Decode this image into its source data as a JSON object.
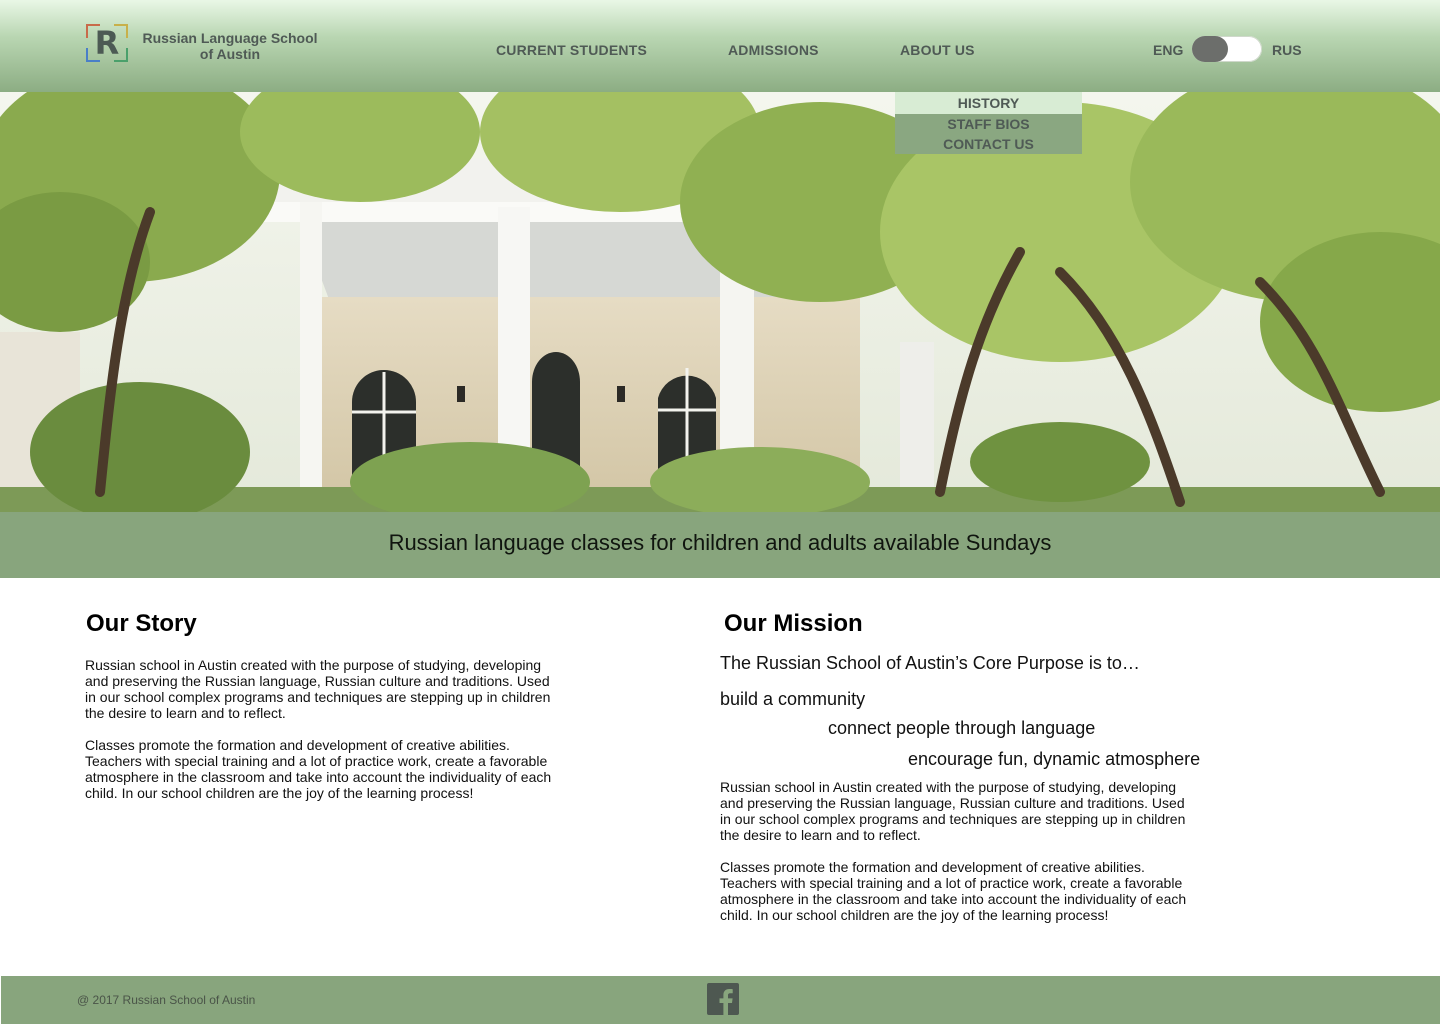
{
  "brand": {
    "logo_letter": "R",
    "name_line1": "Russian Language School",
    "name_line2": "of Austin"
  },
  "nav": {
    "items": [
      "CURRENT STUDENTS",
      "ADMISSIONS",
      "ABOUT US"
    ],
    "dropdown": [
      "HISTORY",
      "STAFF BIOS",
      "CONTACT US"
    ]
  },
  "language": {
    "left": "ENG",
    "right": "RUS",
    "selected": "ENG"
  },
  "banner": {
    "text": "Russian language classes for children and adults available Sundays"
  },
  "story": {
    "title": "Our Story",
    "para1": "Russian school in Austin created with the purpose of studying, developing and preserving the Russian language, Russian culture and traditions. Used in our school complex programs and techniques are stepping up in children the desire to learn and to reflect.",
    "para2": "Classes promote the formation and development of creative abilities. Teachers with special training and a lot of practice work, create a favorable atmosphere in the classroom and take into account the individuality of each child. In our school children are the joy of the learning process!"
  },
  "mission": {
    "title": "Our Mission",
    "intro": "The Russian School of Austin’s Core Purpose is to…",
    "points": [
      "build a community",
      "connect people through language",
      "encourage fun, dynamic atmosphere"
    ],
    "para1": "Russian school in Austin created with the purpose of studying, developing and preserving the Russian language, Russian culture and traditions. Used in our school complex programs and techniques are stepping up in children the desire to learn and to reflect.",
    "para2": "Classes promote the formation and development of creative abilities. Teachers with special training and a lot of practice work, create a favorable atmosphere in the classroom and take into account the individuality of each child. In our school children are the joy of the learning process!"
  },
  "footer": {
    "copyright": "@ 2017 Russian School of Austin",
    "social_icon": "facebook-icon"
  },
  "colors": {
    "header_top": "#e9f7e6",
    "header_bottom": "#8cad83",
    "banner": "#88a57d",
    "dropdown": "#8aa781",
    "dropdown_active": "#d8ecd4",
    "nav_text": "#4f5a55"
  }
}
